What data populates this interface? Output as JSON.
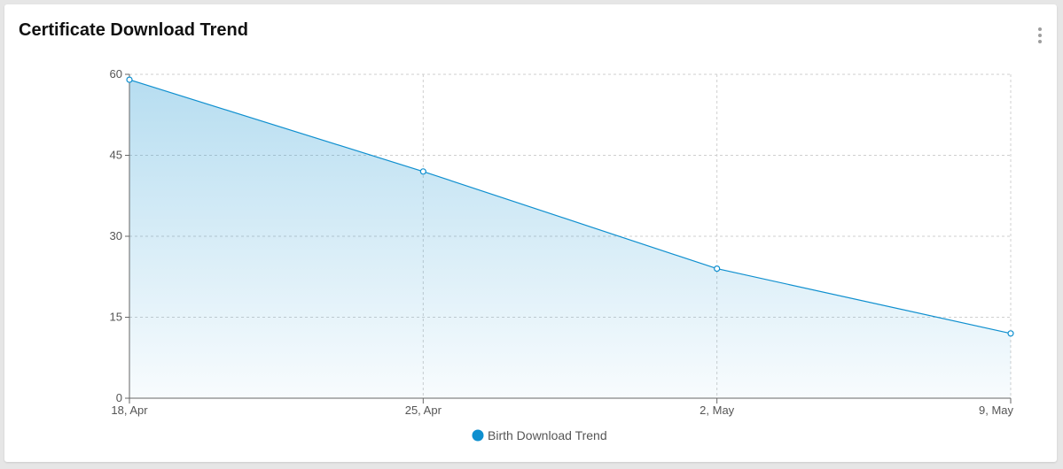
{
  "card": {
    "title": "Certificate Download Trend",
    "menu_icon": "more-vertical-icon"
  },
  "chart_data": {
    "type": "area",
    "title": "Certificate Download Trend",
    "categories": [
      "18, Apr",
      "25, Apr",
      "2, May",
      "9, May"
    ],
    "series": [
      {
        "name": "Birth Download Trend",
        "values": [
          59,
          42,
          24,
          12
        ],
        "color": "#0e8fcf"
      }
    ],
    "ylim": [
      0,
      60
    ],
    "yticks": [
      "0",
      "15",
      "30",
      "45",
      "60"
    ],
    "grid": true,
    "legend": "bottom-center"
  }
}
